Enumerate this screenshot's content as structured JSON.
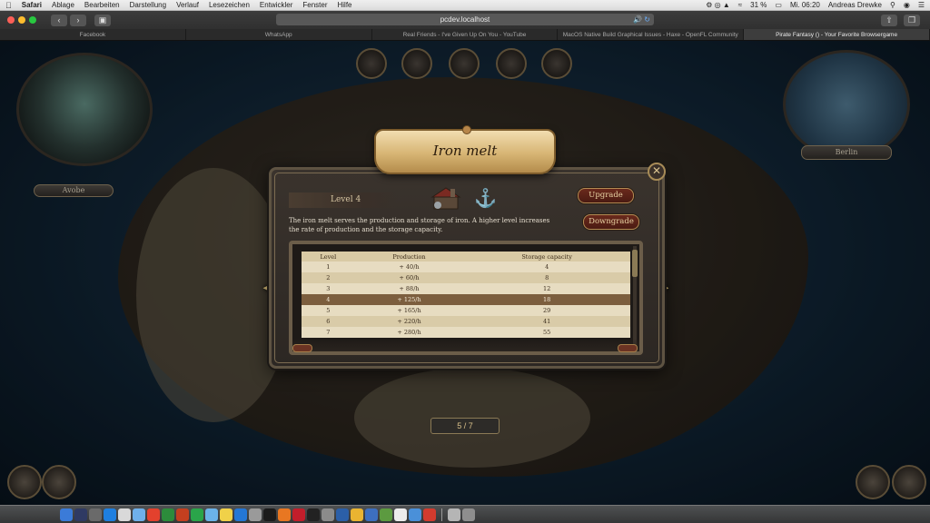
{
  "menubar": {
    "app_name": "Safari",
    "items": [
      "Ablage",
      "Bearbeiten",
      "Darstellung",
      "Verlauf",
      "Lesezeichen",
      "Entwickler",
      "Fenster",
      "Hilfe"
    ],
    "battery": "31 %",
    "clock": "Mi. 06:20",
    "user": "Andreas Drewke"
  },
  "browser": {
    "url": "pcdev.localhost",
    "tabs": [
      "Facebook",
      "WhatsApp",
      "Real Friends - I've Given Up On You - YouTube",
      "MacOS Native Build Graphical Issues - Haxe - OpenFL Community",
      "Pirate Fantasy () - Your Favorite Browsergame"
    ],
    "active_tab": 4
  },
  "game": {
    "player_name": "Avobe",
    "island_name": "Berlin",
    "page_indicator": "5 / 7",
    "dialog": {
      "title": "Iron melt",
      "level_label": "Level 4",
      "upgrade_label": "Upgrade",
      "downgrade_label": "Downgrade",
      "description": "The iron melt serves the production and storage of iron. A higher level increases the rate of production and the storage capacity.",
      "table": {
        "headers": [
          "Level",
          "Production",
          "Storage capacity"
        ],
        "current_level": 4,
        "rows": [
          {
            "level": "1",
            "production": "+ 40/h",
            "storage": "4"
          },
          {
            "level": "2",
            "production": "+ 60/h",
            "storage": "8"
          },
          {
            "level": "3",
            "production": "+ 88/h",
            "storage": "12"
          },
          {
            "level": "4",
            "production": "+ 125/h",
            "storage": "18"
          },
          {
            "level": "5",
            "production": "+ 165/h",
            "storage": "29"
          },
          {
            "level": "6",
            "production": "+ 220/h",
            "storage": "41"
          },
          {
            "level": "7",
            "production": "+ 280/h",
            "storage": "55"
          }
        ]
      }
    }
  },
  "colors": {
    "parchment": "#e7dcc1",
    "current_row": "#7c5e3e",
    "button_red": "#5a2216",
    "gold_trim": "#b38b53"
  }
}
